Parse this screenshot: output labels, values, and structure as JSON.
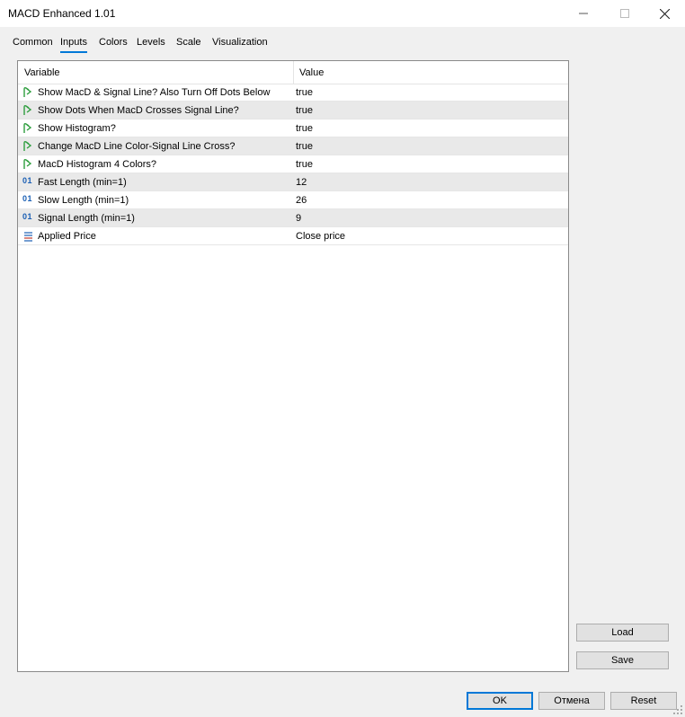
{
  "window": {
    "title": "MACD Enhanced 1.01",
    "controls": {
      "minimize": "—",
      "maximize": "☐",
      "close": "✕"
    }
  },
  "tabs": [
    "Common",
    "Inputs",
    "Colors",
    "Levels",
    "Scale",
    "Visualization"
  ],
  "active_tab": "Inputs",
  "table": {
    "headers": {
      "variable": "Variable",
      "value": "Value"
    },
    "rows": [
      {
        "icon": "bool-arrow-icon",
        "name": "Show MacD & Signal Line? Also Turn Off Dots Below",
        "value": "true"
      },
      {
        "icon": "bool-arrow-icon",
        "name": "Show Dots When MacD Crosses Signal Line?",
        "value": "true"
      },
      {
        "icon": "bool-arrow-icon",
        "name": "Show Histogram?",
        "value": "true"
      },
      {
        "icon": "bool-arrow-icon",
        "name": "Change MacD Line Color-Signal Line Cross?",
        "value": "true"
      },
      {
        "icon": "bool-arrow-icon",
        "name": "MacD Histogram 4 Colors?",
        "value": "true"
      },
      {
        "icon": "integer-icon",
        "icon_text": "01",
        "name": "Fast Length (min=1)",
        "value": "12"
      },
      {
        "icon": "integer-icon",
        "icon_text": "01",
        "name": "Slow Length (min=1)",
        "value": "26"
      },
      {
        "icon": "integer-icon",
        "icon_text": "01",
        "name": "Signal Length (min=1)",
        "value": "9"
      },
      {
        "icon": "enum-list-icon",
        "name": "Applied Price",
        "value": "Close price"
      }
    ]
  },
  "side_buttons": {
    "load": "Load",
    "save": "Save"
  },
  "footer_buttons": {
    "ok": "OK",
    "cancel": "Отмена",
    "reset": "Reset"
  },
  "colors": {
    "accent": "#0078d7",
    "bool_icon": "#2e9e3e",
    "int_icon": "#1a5fb4",
    "enum_icon": "#c0392b"
  }
}
